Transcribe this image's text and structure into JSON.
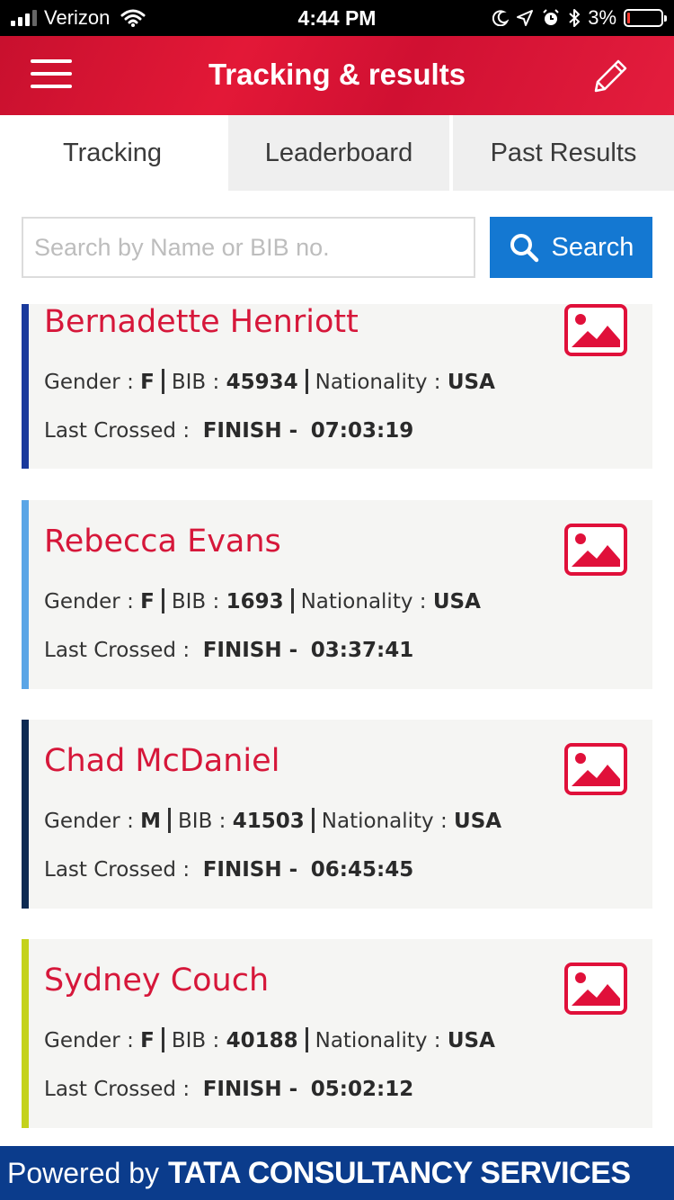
{
  "status_bar": {
    "carrier": "Verizon",
    "time": "4:44 PM",
    "battery": "3%"
  },
  "header": {
    "title": "Tracking & results"
  },
  "tabs": [
    {
      "label": "Tracking",
      "active": true
    },
    {
      "label": "Leaderboard",
      "active": false
    },
    {
      "label": "Past Results",
      "active": false
    }
  ],
  "search": {
    "placeholder": "Search by Name or BIB no.",
    "value": "",
    "button_label": "Search"
  },
  "labels": {
    "gender": "Gender :",
    "bib": "BIB :",
    "nationality": "Nationality :",
    "last_crossed": "Last Crossed :"
  },
  "runners": [
    {
      "name": "Bernadette Henriott",
      "gender": "F",
      "bib": "45934",
      "nationality": "USA",
      "last_crossed": "FINISH -",
      "time": "07:03:19",
      "accent": "#1a3a9c"
    },
    {
      "name": "Rebecca Evans",
      "gender": "F",
      "bib": "1693",
      "nationality": "USA",
      "last_crossed": "FINISH -",
      "time": "03:37:41",
      "accent": "#5aa5e6"
    },
    {
      "name": "Chad McDaniel",
      "gender": "M",
      "bib": "41503",
      "nationality": "USA",
      "last_crossed": "FINISH -",
      "time": "06:45:45",
      "accent": "#0d2a52"
    },
    {
      "name": "Sydney Couch",
      "gender": "F",
      "bib": "40188",
      "nationality": "USA",
      "last_crossed": "FINISH -",
      "time": "05:02:12",
      "accent": "#c4d21c"
    }
  ],
  "footer": {
    "powered_by": "Powered by",
    "brand": "TATA CONSULTANCY SERVICES"
  },
  "colors": {
    "header": "#e31837",
    "name_text": "#d6173a",
    "search_button": "#1478d2",
    "footer": "#0b3c8c"
  }
}
